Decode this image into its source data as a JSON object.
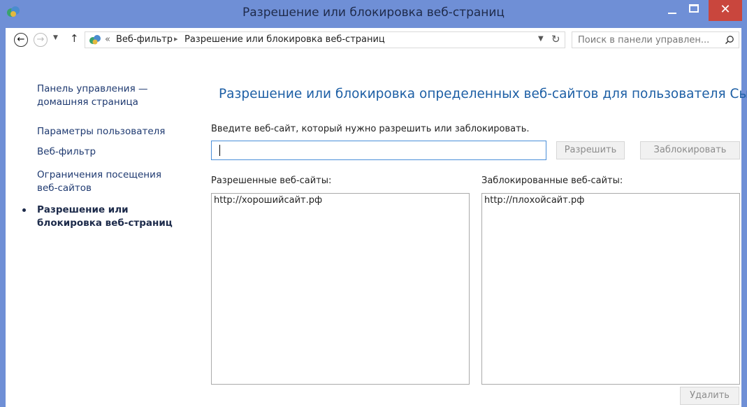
{
  "window": {
    "title": "Разрешение или блокировка веб-страниц",
    "close_glyph": "✕"
  },
  "address_bar": {
    "overflow": "«",
    "crumbs": [
      "Веб-фильтр",
      "Разрешение или блокировка веб-страниц"
    ],
    "separator": "▸",
    "search_placeholder": "Поиск в панели управлен..."
  },
  "sidebar": {
    "items": [
      {
        "label": "Панель управления —\nдомашняя страница"
      },
      {
        "label": "Параметры пользователя"
      },
      {
        "label": "Веб-фильтр"
      },
      {
        "label": "Ограничения посещения\nвеб-сайтов"
      },
      {
        "label": "Разрешение или\nблокировка веб-страниц",
        "active": true
      }
    ]
  },
  "main": {
    "heading": "Разрешение или блокировка определенных веб-сайтов для пользователя Сын",
    "prompt": "Введите веб-сайт, который нужно разрешить или заблокировать.",
    "input_value": "",
    "allow_button": "Разрешить",
    "block_button": "Заблокировать",
    "allowed_label": "Разрешенные веб-сайты:",
    "blocked_label": "Заблокированные веб-сайты:",
    "allowed_sites": [
      "http://хорошийсайт.рф"
    ],
    "blocked_sites": [
      "http://плохойсайт.рф"
    ],
    "delete_button": "Удалить"
  },
  "icons": {
    "app": "family-safety-icon",
    "back": "back-arrow-icon",
    "forward": "forward-arrow-icon",
    "up": "up-arrow-icon",
    "refresh": "refresh-icon",
    "search": "search-icon"
  },
  "colors": {
    "titlebar": "#6f8fd6",
    "close": "#c9463d",
    "heading": "#1d5fa5",
    "link": "#1e3970"
  }
}
